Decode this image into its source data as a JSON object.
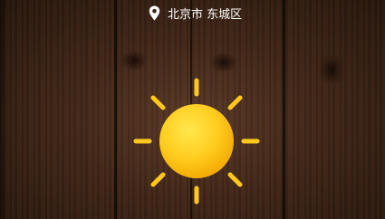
{
  "location": {
    "icon": "location-pin-icon",
    "text": "北京市 东城区"
  },
  "weather": {
    "icon": "sun-icon"
  },
  "colors": {
    "sun_core": "#f7b400",
    "sun_highlight": "#ffe14a",
    "sun_rays": "#ffcc1a",
    "text": "#ffffff"
  }
}
